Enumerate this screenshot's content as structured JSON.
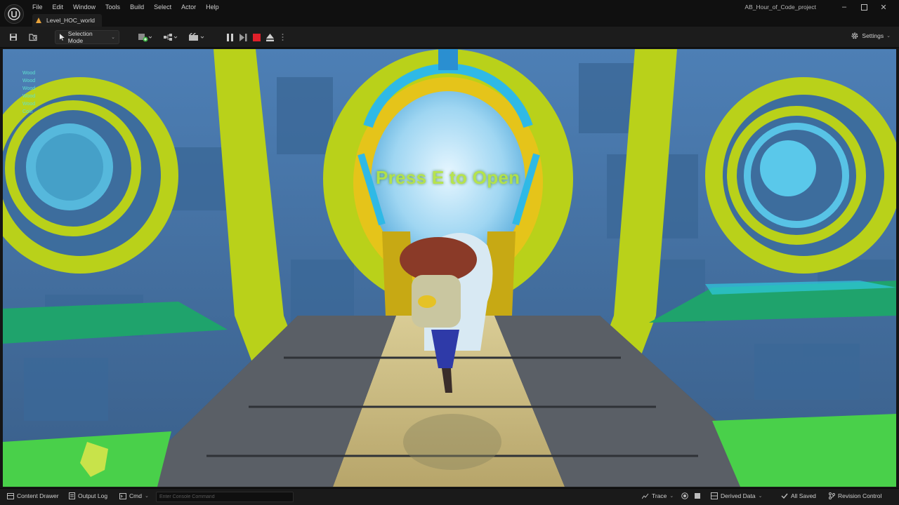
{
  "menu": [
    "File",
    "Edit",
    "Window",
    "Tools",
    "Build",
    "Select",
    "Actor",
    "Help"
  ],
  "level_tab": "Level_HOC_world",
  "project": "AB_Hour_of_Code_project",
  "toolbar": {
    "selection_mode": "Selection Mode",
    "settings": "Settings"
  },
  "viewport": {
    "prompt": "Press E to Open",
    "debug_lines": [
      "Wood",
      "Wood",
      "Wood",
      "Wood",
      "Wood",
      "Coin"
    ]
  },
  "statusbar": {
    "content_drawer": "Content Drawer",
    "output_log": "Output Log",
    "cmd": "Cmd",
    "console_placeholder": "Enter Console Command",
    "trace": "Trace",
    "derived_data": "Derived Data",
    "all_saved": "All Saved",
    "revision_control": "Revision Control"
  },
  "colors": {
    "chrome": "#101010",
    "toolbar": "#1c1c1c",
    "stop_red": "#e0202a",
    "prompt_green": "#b4e33a",
    "wall_blue": "#3f6fa0",
    "arch_yellow": "#b9d11a"
  }
}
